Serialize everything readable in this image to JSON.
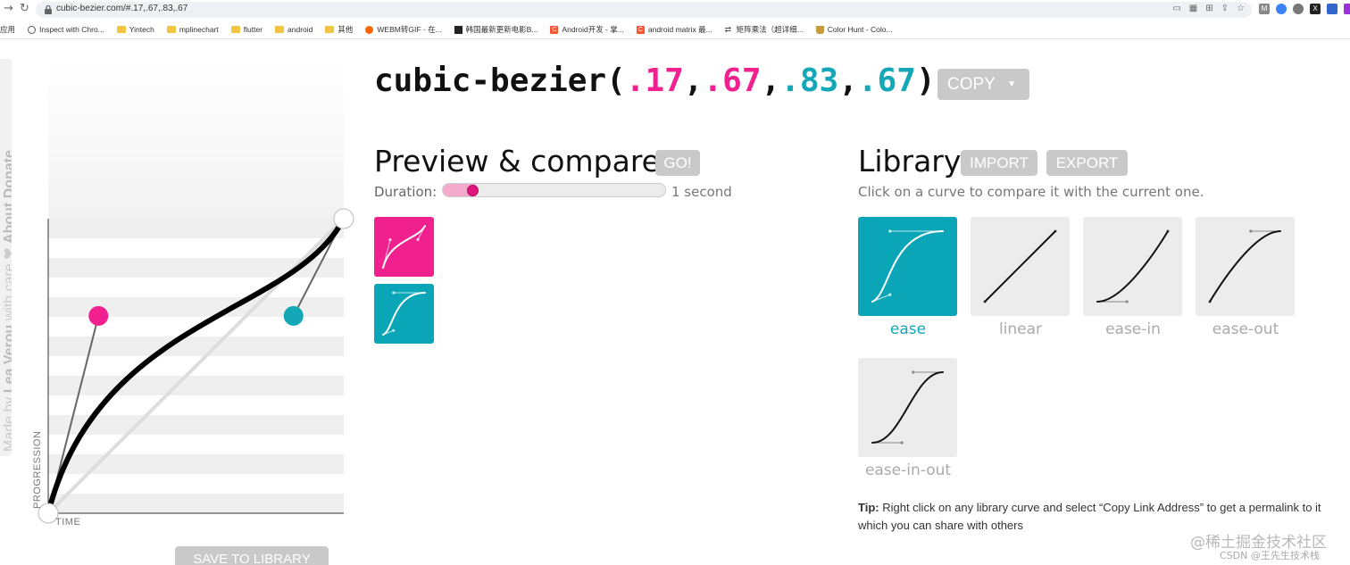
{
  "browser": {
    "url": "cubic-bezier.com/#.17,.67,.83,.67",
    "back_icon": "back-arrow-icon",
    "reload_icon": "reload-icon",
    "bookmarks": [
      {
        "label": "应用",
        "icon": "apps-icon"
      },
      {
        "label": "Inspect with Chro...",
        "icon": "globe-icon"
      },
      {
        "label": "Yintech",
        "icon": "folder-icon"
      },
      {
        "label": "mplinechart",
        "icon": "folder-icon"
      },
      {
        "label": "flutter",
        "icon": "folder-icon"
      },
      {
        "label": "android",
        "icon": "folder-icon"
      },
      {
        "label": "其他",
        "icon": "folder-icon"
      },
      {
        "label": "WEBM转GIF - 在...",
        "icon": "webm-icon"
      },
      {
        "label": "韩国最新更新电影B...",
        "icon": "movie-icon"
      },
      {
        "label": "Android开发 - 掌...",
        "icon": "csdn-icon"
      },
      {
        "label": "android matrix 最...",
        "icon": "csdn-icon"
      },
      {
        "label": "矩阵乘法（超详细...",
        "icon": "shuffle-icon"
      },
      {
        "label": "Color Hunt - Colo...",
        "icon": "cup-icon"
      }
    ]
  },
  "sidebar": {
    "tab_text_prefix": "Made by ",
    "author": "Lea Verou",
    "tab_text_suffix": " with care ❤ ",
    "about": "About",
    "extra": "Donate"
  },
  "curve": {
    "p1": [
      0.17,
      0.67
    ],
    "p2": [
      0.83,
      0.67
    ],
    "axis_y_label": "PROGRESSION",
    "axis_x_label": "TIME",
    "save_label": "SAVE TO LIBRARY",
    "colors": {
      "p1": "#f0208f",
      "p2": "#13a7b8",
      "curve": "#000000"
    }
  },
  "title": {
    "prefix": "cubic-bezier(",
    "v1": ".17",
    "v2": ".67",
    "v3": ".83",
    "v4": ".67",
    "sep": ",",
    "suffix": ")",
    "copy_label": "COPY",
    "copy_caret": "▼"
  },
  "preview": {
    "heading": "Preview & compare",
    "go_label": "GO!",
    "duration_label": "Duration:",
    "duration_value": "1 second",
    "duration_fraction": 0.11,
    "colors": {
      "current": "#f0208f",
      "compare": "#0aa5b7"
    }
  },
  "library": {
    "heading": "Library",
    "import_label": "IMPORT",
    "export_label": "EXPORT",
    "description": "Click on a curve to compare it with the current one.",
    "items": [
      {
        "name": "ease",
        "p1": [
          0.25,
          0.1
        ],
        "p2": [
          0.25,
          1
        ],
        "active": true
      },
      {
        "name": "linear",
        "p1": [
          0,
          0
        ],
        "p2": [
          1,
          1
        ],
        "active": false
      },
      {
        "name": "ease-in",
        "p1": [
          0.42,
          0
        ],
        "p2": [
          1,
          1
        ],
        "active": false
      },
      {
        "name": "ease-out",
        "p1": [
          0,
          0
        ],
        "p2": [
          0.58,
          1
        ],
        "active": false
      },
      {
        "name": "ease-in-out",
        "p1": [
          0.42,
          0
        ],
        "p2": [
          0.58,
          1
        ],
        "active": false
      }
    ],
    "tip_label": "Tip:",
    "tip_text": " Right click on any library curve and select “Copy Link Address” to get a permalink to it which you can share with others"
  },
  "watermark": {
    "line1": "@稀土掘金技术社区",
    "line2": "CSDN @王先生技术栈"
  }
}
